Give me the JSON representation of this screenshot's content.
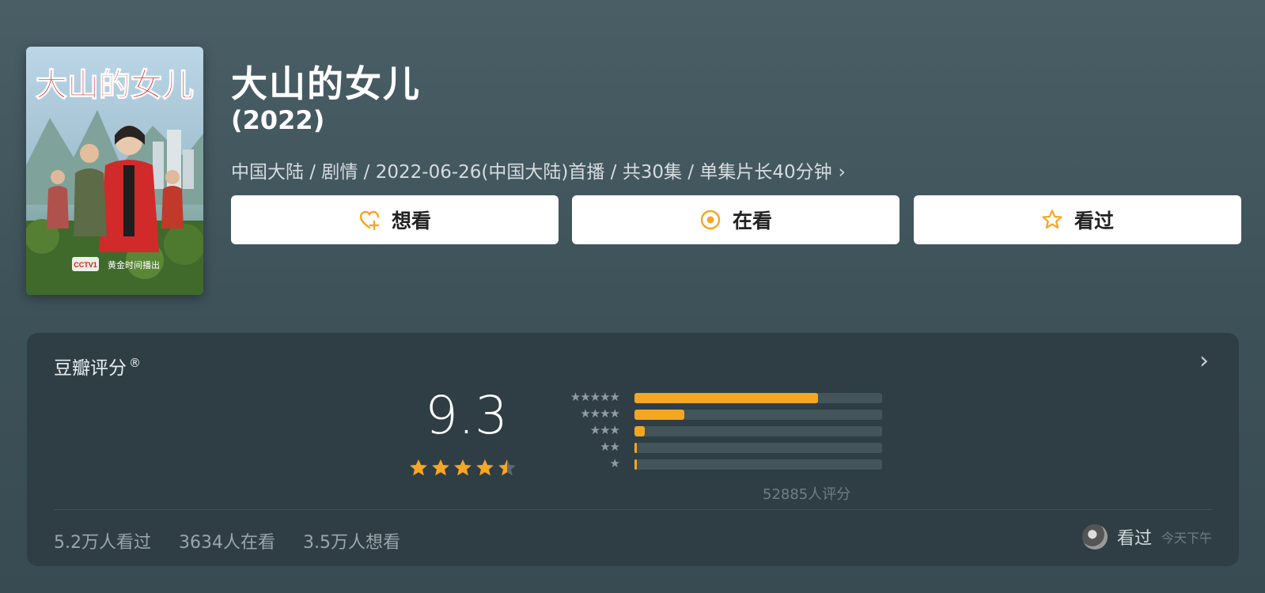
{
  "movie": {
    "title": "大山的女儿",
    "year": "(2022)",
    "meta": "中国大陆 / 剧情 / 2022-06-26(中国大陆)首播 / 共30集 / 单集片长40分钟",
    "poster_title": "大山的女儿",
    "poster_tagline": "黄金时间播出"
  },
  "actions": {
    "want_label": "想看",
    "doing_label": "在看",
    "done_label": "看过"
  },
  "rating": {
    "section_title": "豆瓣评分",
    "registered_mark": "®",
    "score": "9.3",
    "stars": 4.5,
    "count_text": "52885人评分",
    "distribution": [
      {
        "stars": 5,
        "glyphs": "★★★★★",
        "percent": 74
      },
      {
        "stars": 4,
        "glyphs": "★★★★",
        "percent": 20
      },
      {
        "stars": 3,
        "glyphs": "★★★",
        "percent": 4
      },
      {
        "stars": 2,
        "glyphs": "★★",
        "percent": 1
      },
      {
        "stars": 1,
        "glyphs": "★",
        "percent": 1
      }
    ]
  },
  "stats": {
    "watched": "5.2万人看过",
    "watching": "3634人在看",
    "wishlist": "3.5万人想看"
  },
  "friend": {
    "label": "看过",
    "time": "今天下午"
  },
  "colors": {
    "accent": "#f5a623",
    "card_bg": "#2f3e45"
  }
}
